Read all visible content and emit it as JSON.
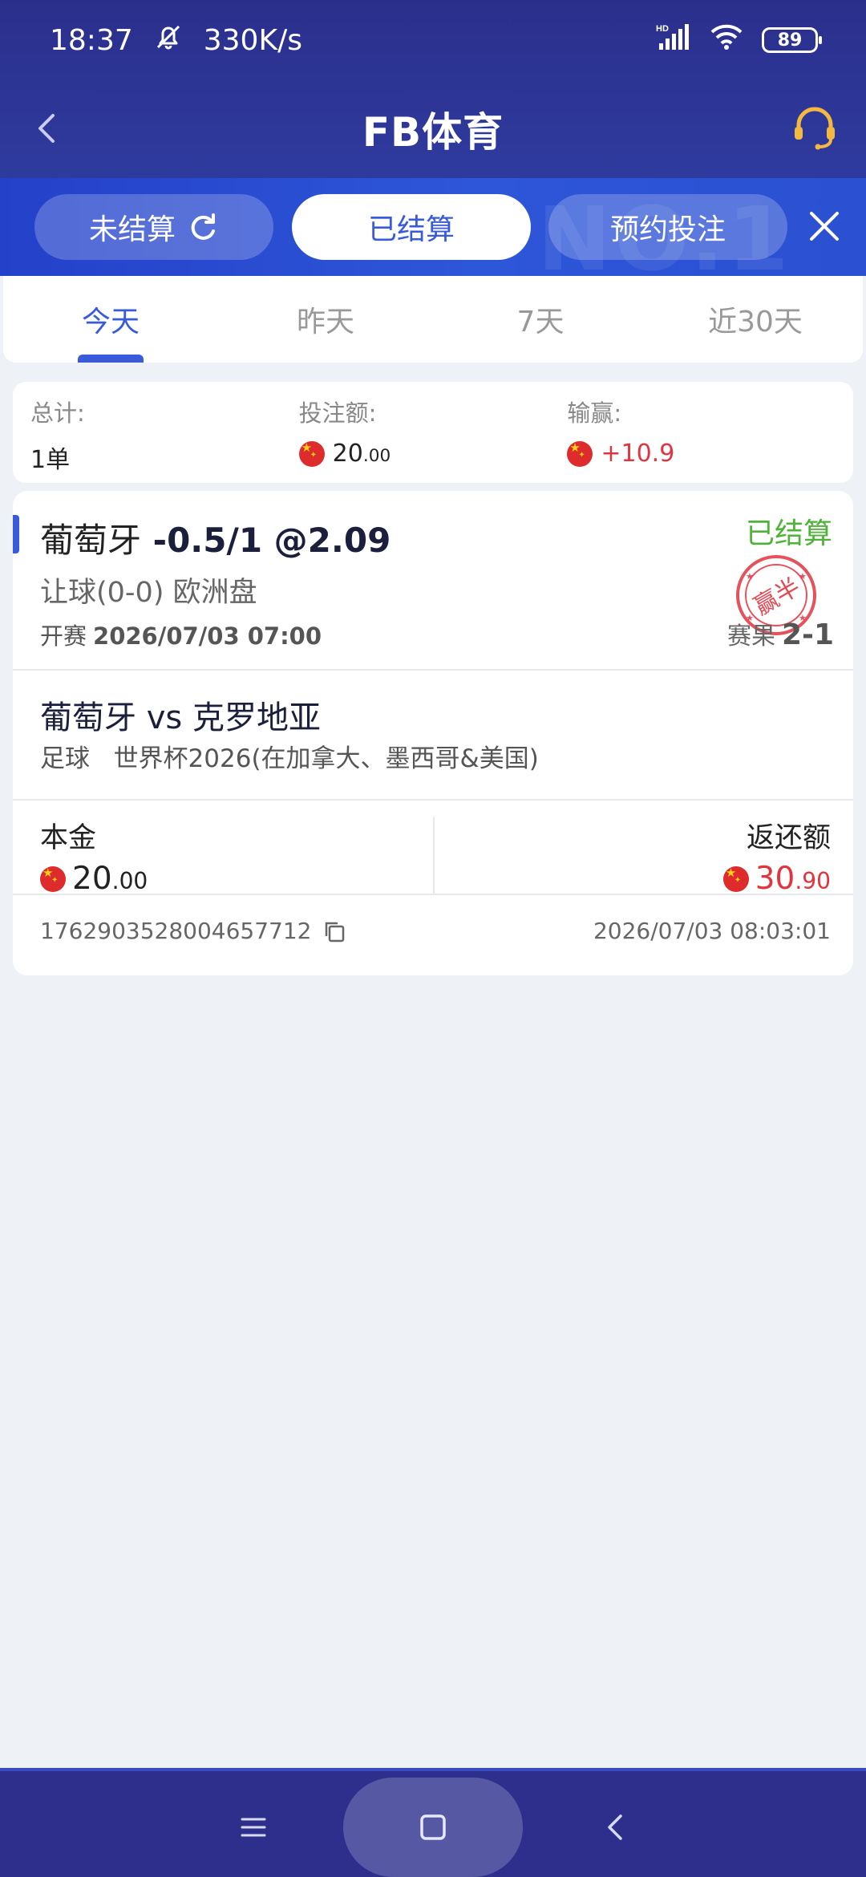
{
  "status_bar": {
    "time": "18:37",
    "speed": "330K/s",
    "battery": "89",
    "network": "HD"
  },
  "title_bar": {
    "title": "FB体育"
  },
  "top_tabs": [
    {
      "label": "未结算",
      "active": false
    },
    {
      "label": "已结算",
      "active": true
    },
    {
      "label": "预约投注",
      "active": false
    }
  ],
  "top_tabs_bg_text": "NO.1",
  "day_tabs": [
    {
      "label": "今天",
      "active": true
    },
    {
      "label": "昨天",
      "active": false
    },
    {
      "label": "7天",
      "active": false
    },
    {
      "label": "近30天",
      "active": false
    }
  ],
  "summary": {
    "total_label": "总计:",
    "total_value": "1单",
    "stake_label": "投注额:",
    "stake_int": "20",
    "stake_dec": ".00",
    "win_label": "输赢:",
    "win_value": "+10.9"
  },
  "bet": {
    "team": "葡萄牙",
    "pick": "-0.5/1 @2.09",
    "status": "已结算",
    "market": "让球(0-0) 欧洲盘",
    "kickoff_label": "开赛",
    "kickoff_time": "2026/07/03 07:00",
    "result_label": "赛果",
    "result_value": "2-1",
    "stamp_text": "赢半",
    "match": "葡萄牙 vs 克罗地亚",
    "sport": "足球",
    "league": "世界杯2026(在加拿大、墨西哥&美国)",
    "principal_label": "本金",
    "principal_int": "20",
    "principal_dec": ".00",
    "return_label": "返还额",
    "return_int": "30",
    "return_dec": ".90",
    "order_id": "1762903528004657712",
    "settle_time": "2026/07/03 08:03:01"
  },
  "colors": {
    "header_bg": "#2b2f8c",
    "tabstrip_bg": "#2e56d8",
    "accent": "#3a5bd9",
    "settled_green": "#4fb33a",
    "win_red": "#e2343f"
  }
}
